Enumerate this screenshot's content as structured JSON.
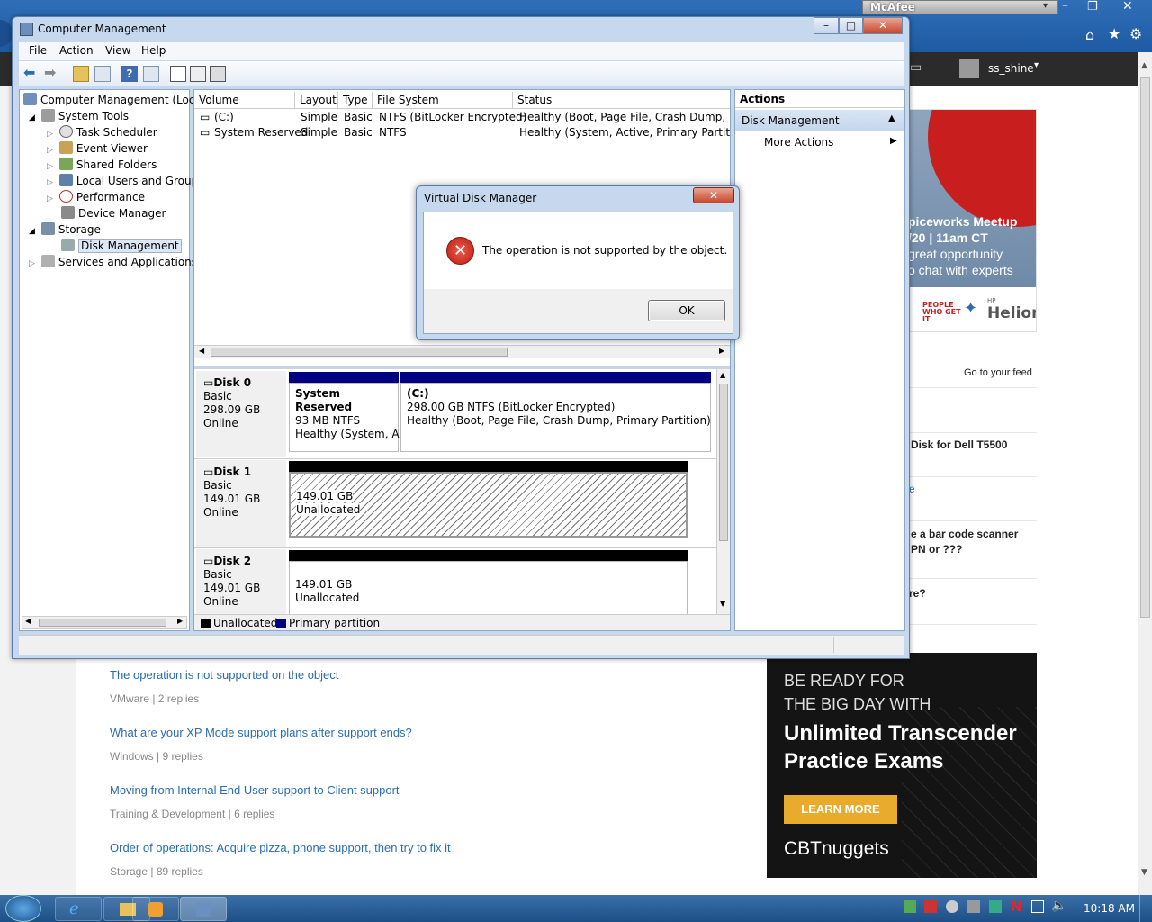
{
  "browser": {
    "mcafee_label": "McAfee",
    "user_name": "ss_shine"
  },
  "ad_spiceworks": {
    "lines": [
      "piceworks Meetup",
      "/20 | 11am CT",
      "great opportunity",
      "o chat with experts"
    ],
    "logo1": "PEOPLE WHO GET IT",
    "logo2": "Helion",
    "logo2_small": "HP"
  },
  "sidebar": {
    "feed_link": "Go to your feed",
    "items": [
      "Disk for Dell T5500",
      "e",
      "e a bar code scanner",
      "PN or ???",
      "re?"
    ]
  },
  "discussions": [
    {
      "title": "The operation is not supported on the object",
      "meta": "VMware | 2 replies"
    },
    {
      "title": "What are your XP Mode support plans after support ends?",
      "meta": "Windows | 9 replies"
    },
    {
      "title": "Moving from Internal End User support to Client support",
      "meta": "Training & Development | 6 replies"
    },
    {
      "title": "Order of operations: Acquire pizza, phone support, then try to fix it",
      "meta": "Storage | 89 replies"
    }
  ],
  "ad_cbt": {
    "line1": "BE READY FOR",
    "line2": "THE BIG DAY WITH",
    "headline1": "Unlimited Transcender",
    "headline2": "Practice Exams",
    "button": "LEARN MORE",
    "brand": "CBTnuggets"
  },
  "window": {
    "title": "Computer Management",
    "menu": [
      "File",
      "Action",
      "View",
      "Help"
    ]
  },
  "tree": [
    {
      "label": "Computer Management (Local"
    },
    {
      "label": "System Tools"
    },
    {
      "label": "Task Scheduler"
    },
    {
      "label": "Event Viewer"
    },
    {
      "label": "Shared Folders"
    },
    {
      "label": "Local Users and Groups"
    },
    {
      "label": "Performance"
    },
    {
      "label": "Device Manager"
    },
    {
      "label": "Storage"
    },
    {
      "label": "Disk Management"
    },
    {
      "label": "Services and Applications"
    }
  ],
  "volume_table": {
    "columns": [
      "Volume",
      "Layout",
      "Type",
      "File System",
      "Status"
    ],
    "rows": [
      [
        "(C:)",
        "Simple",
        "Basic",
        "NTFS (BitLocker Encrypted)",
        "Healthy (Boot, Page File, Crash Dump, Prima"
      ],
      [
        "System Reserved",
        "Simple",
        "Basic",
        "NTFS",
        "Healthy (System, Active, Primary Partition)"
      ]
    ]
  },
  "disks": [
    {
      "name": "Disk 0",
      "type": "Basic",
      "size": "298.09 GB",
      "state": "Online",
      "parts": [
        {
          "name": "System Reserved",
          "size": "93 MB NTFS",
          "status": "Healthy (System, Act"
        },
        {
          "name": "(C:)",
          "size": "298.00 GB NTFS (BitLocker Encrypted)",
          "status": "Healthy (Boot, Page File, Crash Dump, Primary Partition)"
        }
      ]
    },
    {
      "name": "Disk 1",
      "type": "Basic",
      "size": "149.01 GB",
      "state": "Online",
      "parts": [
        {
          "size": "149.01 GB",
          "status": "Unallocated"
        }
      ]
    },
    {
      "name": "Disk 2",
      "type": "Basic",
      "size": "149.01 GB",
      "state": "Online",
      "parts": [
        {
          "size": "149.01 GB",
          "status": "Unallocated"
        }
      ]
    }
  ],
  "legend": {
    "unallocated": "Unallocated",
    "primary": "Primary partition",
    "unallocated_color": "#000000",
    "primary_color": "#000080"
  },
  "actions": {
    "header": "Actions",
    "section": "Disk Management",
    "more": "More Actions"
  },
  "dialog": {
    "title": "Virtual Disk Manager",
    "message": "The operation is not supported by the object.",
    "ok": "OK"
  },
  "taskbar": {
    "clock": "10:18 AM"
  }
}
